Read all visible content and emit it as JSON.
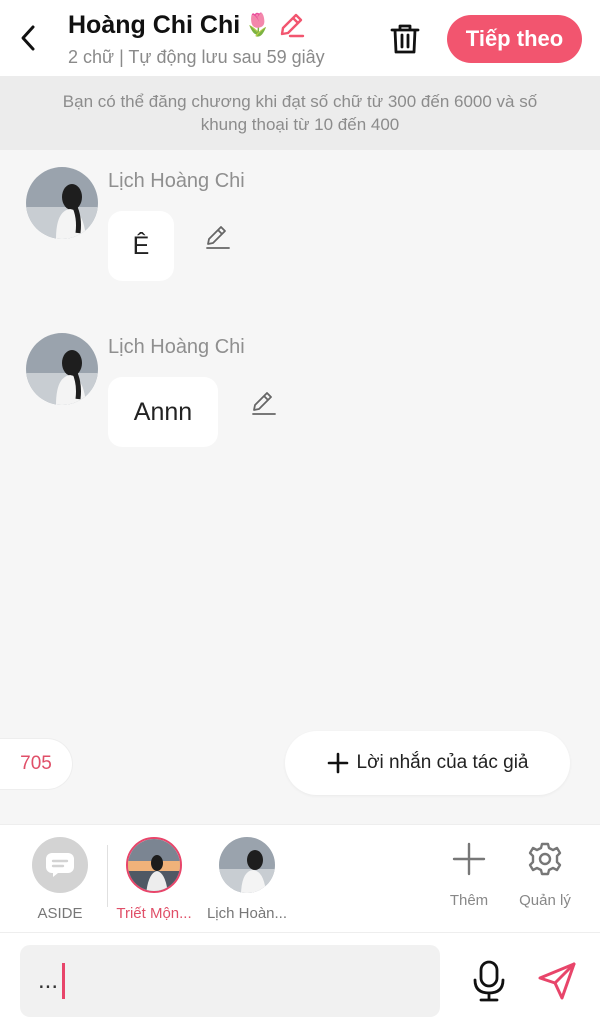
{
  "header": {
    "title": "Hoàng Chi Chi",
    "title_emoji": "🌷",
    "subtitle": "2 chữ | Tự động lưu sau 59 giây",
    "next_button": "Tiếp theo",
    "accent_color": "#f2556f"
  },
  "notice": "Bạn có thể đăng chương khi đạt số chữ từ 300 đến 6000 và số khung thoại từ 10 đến 400",
  "messages": [
    {
      "sender": "Lịch Hoàng Chi",
      "text": "Ê"
    },
    {
      "sender": "Lịch Hoàng Chi",
      "text": "Annn"
    }
  ],
  "counter": "705",
  "author_note_button": "Lời nhắn của tác giả",
  "characters": [
    {
      "label": "ASIDE",
      "icon": "chat-bubble-icon",
      "selected": false
    },
    {
      "label": "Triết Mộn...",
      "selected": true
    },
    {
      "label": "Lịch Hoàn...",
      "selected": false
    }
  ],
  "tools": {
    "add_label": "Thêm",
    "manage_label": "Quản lý"
  },
  "composer": {
    "value": "..."
  }
}
